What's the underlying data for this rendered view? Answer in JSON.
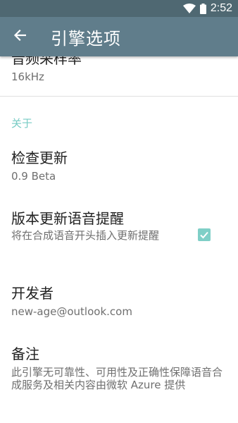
{
  "status_bar": {
    "time": "2:52"
  },
  "app_bar": {
    "title": "引擎选项"
  },
  "prefs": {
    "sample_rate": {
      "title": "音频采样率",
      "summary": "16kHz"
    },
    "category_about": "关于",
    "check_update": {
      "title": "检查更新",
      "summary": "0.9 Beta"
    },
    "update_voice_reminder": {
      "title": "版本更新语音提醒",
      "summary": "将在合成语音开头插入更新提醒",
      "checked": true
    },
    "developer": {
      "title": "开发者",
      "summary": "new-age@outlook.com"
    },
    "notes": {
      "title": "备注",
      "summary": "此引擎无可靠性、可用性及正确性保障语音合成服务及相关内容由微软 Azure 提供"
    }
  },
  "colors": {
    "status_bar": "#4f6872",
    "app_bar": "#607d8b",
    "accent": "#77cbc4"
  },
  "icons": [
    "wifi-icon",
    "battery-icon",
    "back-arrow-icon",
    "checkbox-checked-icon"
  ]
}
